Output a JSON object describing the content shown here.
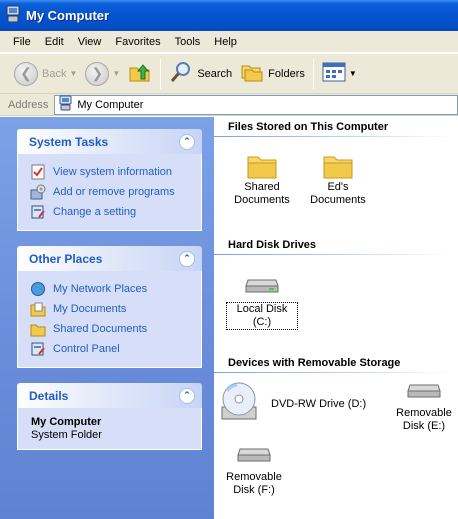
{
  "window": {
    "title": "My Computer"
  },
  "menu": [
    "File",
    "Edit",
    "View",
    "Favorites",
    "Tools",
    "Help"
  ],
  "toolbar": {
    "back": "Back",
    "search": "Search",
    "folders": "Folders"
  },
  "address": {
    "label": "Address",
    "value": "My Computer"
  },
  "system_tasks": {
    "title": "System Tasks",
    "items": [
      "View system information",
      "Add or remove programs",
      "Change a setting"
    ]
  },
  "other_places": {
    "title": "Other Places",
    "items": [
      "My Network Places",
      "My Documents",
      "Shared Documents",
      "Control Panel"
    ]
  },
  "details": {
    "title": "Details",
    "name": "My Computer",
    "type": "System Folder"
  },
  "groups": {
    "files": {
      "heading": "Files Stored on This Computer",
      "items": [
        {
          "l1": "Shared",
          "l2": "Documents"
        },
        {
          "l1": "Ed's",
          "l2": "Documents"
        }
      ]
    },
    "hdd": {
      "heading": "Hard Disk Drives",
      "items": [
        {
          "label": "Local Disk (C:)"
        }
      ]
    },
    "removable": {
      "heading": "Devices with Removable Storage",
      "items": [
        {
          "label": "DVD-RW Drive (D:)"
        },
        {
          "l1": "Removable",
          "l2": "Disk (E:)"
        },
        {
          "l1": "Removable",
          "l2": "Disk (F:)"
        }
      ]
    }
  },
  "colors": {
    "title_bar": "#0553d0",
    "task_pane": "#6c8fdc",
    "link": "#215dc6",
    "menu_bg": "#ece9d8"
  }
}
